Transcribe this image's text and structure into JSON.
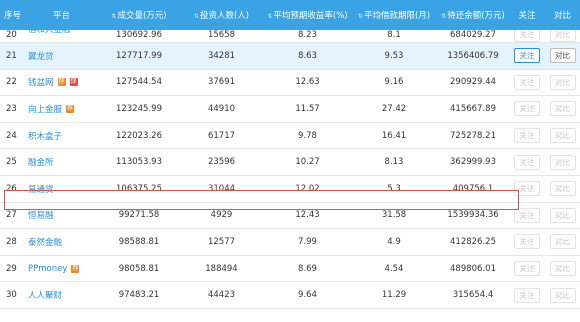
{
  "headers": {
    "index": "序号",
    "platform": "平台",
    "volume": "成交量(万元)",
    "investors": "投资人数(人)",
    "rate": "平均预期收益率(%)",
    "term": "平均借款期限(月)",
    "balance": "待还余额(万元)",
    "follow": "关注",
    "compare": "对比"
  },
  "sort_icon": "⇅",
  "rows": [
    {
      "idx": "20",
      "name": "信和大金融",
      "badges": [],
      "volume": "130692.96",
      "investors": "15658",
      "rate": "8.23",
      "term": "8.1",
      "balance": "684029.27",
      "follow": "关注",
      "compare": "对比"
    },
    {
      "idx": "21",
      "name": "翼龙贷",
      "badges": [],
      "volume": "127717.99",
      "investors": "34281",
      "rate": "8.63",
      "term": "9.53",
      "balance": "1356406.79",
      "follow": "关注",
      "compare": "对比"
    },
    {
      "idx": "22",
      "name": "钱盆网",
      "badges": [
        "荐",
        "保"
      ],
      "volume": "127544.54",
      "investors": "37691",
      "rate": "12.63",
      "term": "9.16",
      "balance": "290929.44",
      "follow": "关注",
      "compare": "对比"
    },
    {
      "idx": "23",
      "name": "向上金服",
      "badges": [
        "荐"
      ],
      "volume": "123245.99",
      "investors": "44910",
      "rate": "11.57",
      "term": "27.42",
      "balance": "415667.89",
      "follow": "关注",
      "compare": "对比"
    },
    {
      "idx": "24",
      "name": "积木盒子",
      "badges": [],
      "volume": "122023.26",
      "investors": "61717",
      "rate": "9.78",
      "term": "16.41",
      "balance": "725278.21",
      "follow": "关注",
      "compare": "对比"
    },
    {
      "idx": "25",
      "name": "融金所",
      "badges": [],
      "volume": "113053.93",
      "investors": "23596",
      "rate": "10.27",
      "term": "8.13",
      "balance": "362999.93",
      "follow": "关注",
      "compare": "对比"
    },
    {
      "idx": "26",
      "name": "易通贷",
      "badges": [],
      "volume": "106375.25",
      "investors": "31044",
      "rate": "12.02",
      "term": "5.3",
      "balance": "409756.1",
      "follow": "关注",
      "compare": "对比"
    },
    {
      "idx": "27",
      "name": "恒易融",
      "badges": [],
      "volume": "99271.58",
      "investors": "4929",
      "rate": "12.43",
      "term": "31.58",
      "balance": "1539934.36",
      "follow": "关注",
      "compare": "对比"
    },
    {
      "idx": "28",
      "name": "泰然金融",
      "badges": [],
      "volume": "98588.81",
      "investors": "12577",
      "rate": "7.99",
      "term": "4.9",
      "balance": "412826.25",
      "follow": "关注",
      "compare": "对比"
    },
    {
      "idx": "29",
      "name": "PPmoney",
      "badges": [
        "荐"
      ],
      "volume": "98058.81",
      "investors": "188494",
      "rate": "8.69",
      "term": "4.54",
      "balance": "489806.01",
      "follow": "关注",
      "compare": "对比"
    },
    {
      "idx": "30",
      "name": "人人聚财",
      "badges": [],
      "volume": "97483.21",
      "investors": "44423",
      "rate": "9.64",
      "term": "11.29",
      "balance": "315654.4",
      "follow": "关注",
      "compare": "对比"
    }
  ],
  "highlighted_row_index": 1,
  "selected_row_index": 6,
  "colors": {
    "header_bg": "#3aa3e6",
    "link": "#2d8fd6",
    "highlight_bg": "#e4f3fc",
    "selection_border": "#d9534f"
  }
}
